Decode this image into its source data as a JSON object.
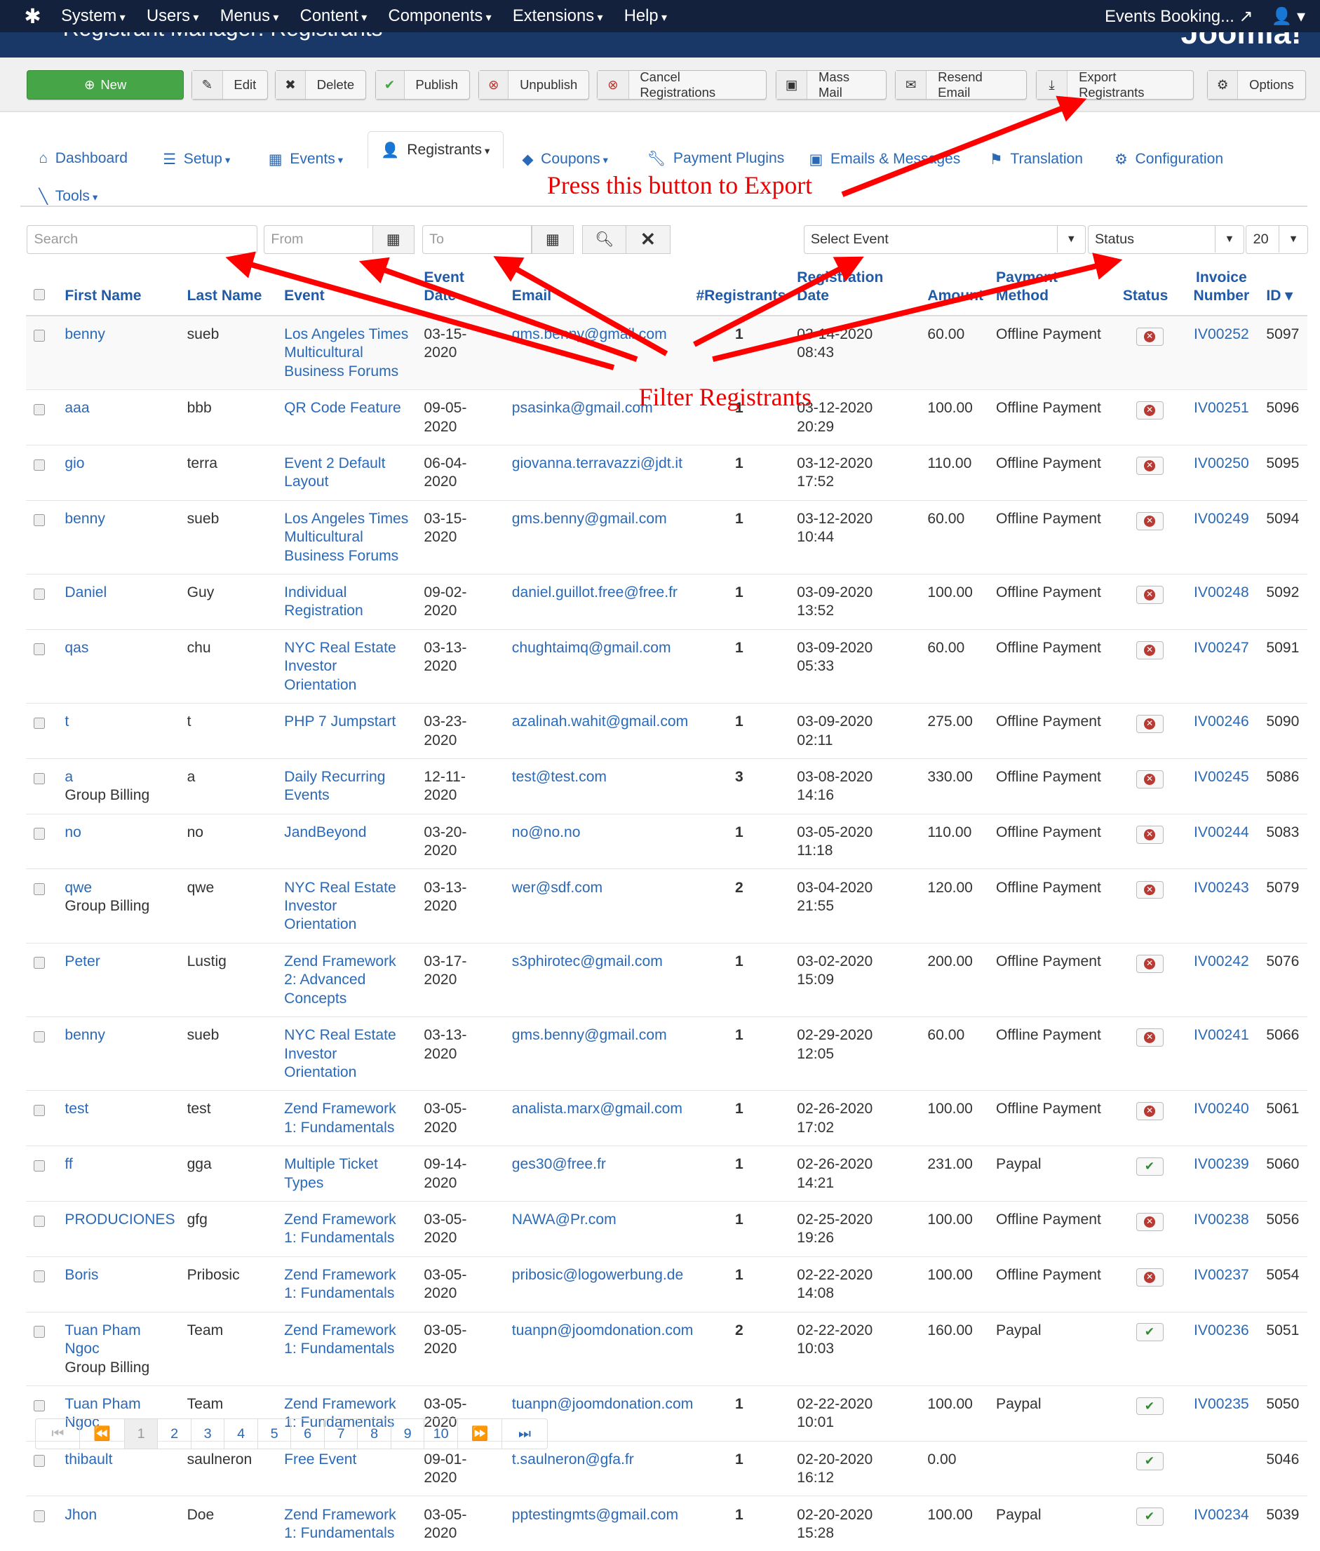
{
  "topnav": {
    "menus": [
      "System",
      "Users",
      "Menus",
      "Content",
      "Components",
      "Extensions",
      "Help"
    ],
    "site_link": "Events Booking...",
    "user_icon": "user-icon"
  },
  "header": {
    "title": "Registrant Manager: Registrants",
    "logo": "Joomla!"
  },
  "toolbar": {
    "buttons": [
      {
        "label": "New",
        "icon": "plus-circle-icon"
      },
      {
        "label": "Edit",
        "icon": "edit-icon"
      },
      {
        "label": "Delete",
        "icon": "x-icon"
      },
      {
        "label": "Publish",
        "icon": "check-icon"
      },
      {
        "label": "Unpublish",
        "icon": "x-circle-icon"
      },
      {
        "label": "Cancel Registrations",
        "icon": "x-circle-icon"
      },
      {
        "label": "Mass Mail",
        "icon": "mail-icon"
      },
      {
        "label": "Resend Email",
        "icon": "envelope-icon"
      },
      {
        "label": "Export Registrants",
        "icon": "download-icon"
      },
      {
        "label": "Options",
        "icon": "gear-icon"
      }
    ]
  },
  "subnav": {
    "items": [
      {
        "label": "Dashboard",
        "icon": "home-icon",
        "dropdown": false
      },
      {
        "label": "Setup",
        "icon": "list-icon",
        "dropdown": true
      },
      {
        "label": "Events",
        "icon": "calendar-icon",
        "dropdown": true
      },
      {
        "label": "Registrants",
        "icon": "user-icon",
        "dropdown": true,
        "active": true
      },
      {
        "label": "Coupons",
        "icon": "tag-icon",
        "dropdown": true
      },
      {
        "label": "Payment Plugins",
        "icon": "wrench-icon",
        "dropdown": false
      },
      {
        "label": "Emails & Messages",
        "icon": "mail-icon",
        "dropdown": false
      },
      {
        "label": "Translation",
        "icon": "flag-icon",
        "dropdown": false
      },
      {
        "label": "Configuration",
        "icon": "gear-icon",
        "dropdown": false
      },
      {
        "label": "Tools",
        "icon": "tools-icon",
        "dropdown": true
      }
    ]
  },
  "filters": {
    "search_placeholder": "Search",
    "from_placeholder": "From",
    "to_placeholder": "To",
    "event_select": "Select Event",
    "status_select": "Status",
    "limit": "20"
  },
  "annotations": {
    "export": "Press this button to Export",
    "filter": "Filter Registrants",
    "color": "#ff0000"
  },
  "table": {
    "headers": [
      "First Name",
      "Last Name",
      "Event",
      "Event Date",
      "Email",
      "#Registrants",
      "Registration Date",
      "Amount",
      "Payment Method",
      "Status",
      "Invoice Number",
      "ID"
    ],
    "rows": [
      {
        "first": "benny",
        "group": "",
        "last": "sueb",
        "event": "Los Angeles Times Multicultural Business Forums",
        "event_date": "03-15-2020",
        "email": "gms.benny@gmail.com",
        "count": "1",
        "reg_date": "03-14-2020 08:43",
        "amount": "60.00",
        "payment": "Offline Payment",
        "status": "unpaid",
        "invoice": "IV00252",
        "id": "5097"
      },
      {
        "first": "aaa",
        "group": "",
        "last": "bbb",
        "event": "QR Code Feature",
        "event_date": "09-05-2020",
        "email": "psasinka@gmail.com",
        "count": "1",
        "reg_date": "03-12-2020 20:29",
        "amount": "100.00",
        "payment": "Offline Payment",
        "status": "unpaid",
        "invoice": "IV00251",
        "id": "5096"
      },
      {
        "first": "gio",
        "group": "",
        "last": "terra",
        "event": "Event 2 Default Layout",
        "event_date": "06-04-2020",
        "email": "giovanna.terravazzi@jdt.it",
        "count": "1",
        "reg_date": "03-12-2020 17:52",
        "amount": "110.00",
        "payment": "Offline Payment",
        "status": "unpaid",
        "invoice": "IV00250",
        "id": "5095"
      },
      {
        "first": "benny",
        "group": "",
        "last": "sueb",
        "event": "Los Angeles Times Multicultural Business Forums",
        "event_date": "03-15-2020",
        "email": "gms.benny@gmail.com",
        "count": "1",
        "reg_date": "03-12-2020 10:44",
        "amount": "60.00",
        "payment": "Offline Payment",
        "status": "unpaid",
        "invoice": "IV00249",
        "id": "5094"
      },
      {
        "first": "Daniel",
        "group": "",
        "last": "Guy",
        "event": "Individual Registration",
        "event_date": "09-02-2020",
        "email": "daniel.guillot.free@free.fr",
        "count": "1",
        "reg_date": "03-09-2020 13:52",
        "amount": "100.00",
        "payment": "Offline Payment",
        "status": "unpaid",
        "invoice": "IV00248",
        "id": "5092"
      },
      {
        "first": "qas",
        "group": "",
        "last": "chu",
        "event": "NYC Real Estate Investor Orientation",
        "event_date": "03-13-2020",
        "email": "chughtaimq@gmail.com",
        "count": "1",
        "reg_date": "03-09-2020 05:33",
        "amount": "60.00",
        "payment": "Offline Payment",
        "status": "unpaid",
        "invoice": "IV00247",
        "id": "5091"
      },
      {
        "first": "t",
        "group": "",
        "last": "t",
        "event": "PHP 7 Jumpstart",
        "event_date": "03-23-2020",
        "email": "azalinah.wahit@gmail.com",
        "count": "1",
        "reg_date": "03-09-2020 02:11",
        "amount": "275.00",
        "payment": "Offline Payment",
        "status": "unpaid",
        "invoice": "IV00246",
        "id": "5090"
      },
      {
        "first": "a",
        "group": "Group Billing",
        "last": "a",
        "event": "Daily Recurring Events",
        "event_date": "12-11-2020",
        "email": "test@test.com",
        "count": "3",
        "reg_date": "03-08-2020 14:16",
        "amount": "330.00",
        "payment": "Offline Payment",
        "status": "unpaid",
        "invoice": "IV00245",
        "id": "5086"
      },
      {
        "first": "no",
        "group": "",
        "last": "no",
        "event": "JandBeyond",
        "event_date": "03-20-2020",
        "email": "no@no.no",
        "count": "1",
        "reg_date": "03-05-2020 11:18",
        "amount": "110.00",
        "payment": "Offline Payment",
        "status": "unpaid",
        "invoice": "IV00244",
        "id": "5083"
      },
      {
        "first": "qwe",
        "group": "Group Billing",
        "last": "qwe",
        "event": "NYC Real Estate Investor Orientation",
        "event_date": "03-13-2020",
        "email": "wer@sdf.com",
        "count": "2",
        "reg_date": "03-04-2020 21:55",
        "amount": "120.00",
        "payment": "Offline Payment",
        "status": "unpaid",
        "invoice": "IV00243",
        "id": "5079"
      },
      {
        "first": "Peter",
        "group": "",
        "last": "Lustig",
        "event": "Zend Framework 2: Advanced Concepts",
        "event_date": "03-17-2020",
        "email": "s3phirotec@gmail.com",
        "count": "1",
        "reg_date": "03-02-2020 15:09",
        "amount": "200.00",
        "payment": "Offline Payment",
        "status": "unpaid",
        "invoice": "IV00242",
        "id": "5076"
      },
      {
        "first": "benny",
        "group": "",
        "last": "sueb",
        "event": "NYC Real Estate Investor Orientation",
        "event_date": "03-13-2020",
        "email": "gms.benny@gmail.com",
        "count": "1",
        "reg_date": "02-29-2020 12:05",
        "amount": "60.00",
        "payment": "Offline Payment",
        "status": "unpaid",
        "invoice": "IV00241",
        "id": "5066"
      },
      {
        "first": "test",
        "group": "",
        "last": "test",
        "event": "Zend Framework 1: Fundamentals",
        "event_date": "03-05-2020",
        "email": "analista.marx@gmail.com",
        "count": "1",
        "reg_date": "02-26-2020 17:02",
        "amount": "100.00",
        "payment": "Offline Payment",
        "status": "unpaid",
        "invoice": "IV00240",
        "id": "5061"
      },
      {
        "first": "ff",
        "group": "",
        "last": "gga",
        "event": "Multiple Ticket Types",
        "event_date": "09-14-2020",
        "email": "ges30@free.fr",
        "count": "1",
        "reg_date": "02-26-2020 14:21",
        "amount": "231.00",
        "payment": "Paypal",
        "status": "paid",
        "invoice": "IV00239",
        "id": "5060"
      },
      {
        "first": "PRODUCIONES",
        "group": "",
        "last": "gfg",
        "event": "Zend Framework 1: Fundamentals",
        "event_date": "03-05-2020",
        "email": "NAWA@Pr.com",
        "count": "1",
        "reg_date": "02-25-2020 19:26",
        "amount": "100.00",
        "payment": "Offline Payment",
        "status": "unpaid",
        "invoice": "IV00238",
        "id": "5056"
      },
      {
        "first": "Boris",
        "group": "",
        "last": "Pribosic",
        "event": "Zend Framework 1: Fundamentals",
        "event_date": "03-05-2020",
        "email": "pribosic@logowerbung.de",
        "count": "1",
        "reg_date": "02-22-2020 14:08",
        "amount": "100.00",
        "payment": "Offline Payment",
        "status": "unpaid",
        "invoice": "IV00237",
        "id": "5054"
      },
      {
        "first": "Tuan Pham Ngoc",
        "group": "Group Billing",
        "last": "Team",
        "event": "Zend Framework 1: Fundamentals",
        "event_date": "03-05-2020",
        "email": "tuanpn@joomdonation.com",
        "count": "2",
        "reg_date": "02-22-2020 10:03",
        "amount": "160.00",
        "payment": "Paypal",
        "status": "paid",
        "invoice": "IV00236",
        "id": "5051"
      },
      {
        "first": "Tuan Pham Ngoc",
        "group": "",
        "last": "Team",
        "event": "Zend Framework 1: Fundamentals",
        "event_date": "03-05-2020",
        "email": "tuanpn@joomdonation.com",
        "count": "1",
        "reg_date": "02-22-2020 10:01",
        "amount": "100.00",
        "payment": "Paypal",
        "status": "paid",
        "invoice": "IV00235",
        "id": "5050"
      },
      {
        "first": "thibault",
        "group": "",
        "last": "saulneron",
        "event": "Free Event",
        "event_date": "09-01-2020",
        "email": "t.saulneron@gfa.fr",
        "count": "1",
        "reg_date": "02-20-2020 16:12",
        "amount": "0.00",
        "payment": "",
        "status": "paid",
        "invoice": "",
        "id": "5046"
      },
      {
        "first": "Jhon",
        "group": "",
        "last": "Doe",
        "event": "Zend Framework 1: Fundamentals",
        "event_date": "03-05-2020",
        "email": "pptestingmts@gmail.com",
        "count": "1",
        "reg_date": "02-20-2020 15:28",
        "amount": "100.00",
        "payment": "Paypal",
        "status": "paid",
        "invoice": "IV00234",
        "id": "5039"
      }
    ]
  },
  "pagination": {
    "first": "⏮",
    "prev": "⏪",
    "pages": [
      "1",
      "2",
      "3",
      "4",
      "5",
      "6",
      "7",
      "8",
      "9",
      "10"
    ],
    "current": "1",
    "next": "⏩",
    "last": "⏭"
  }
}
